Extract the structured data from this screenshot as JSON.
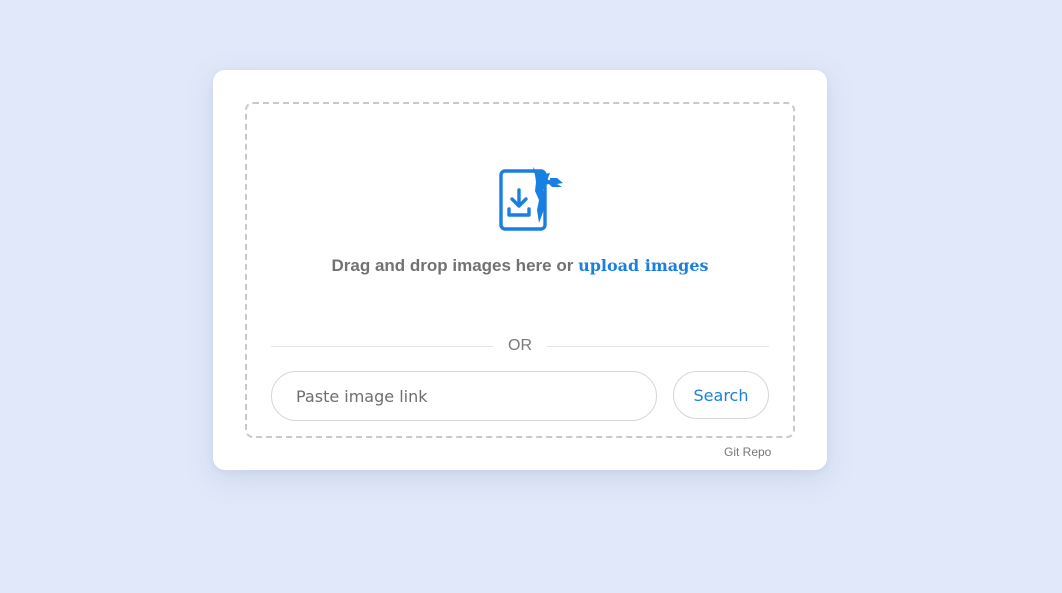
{
  "upload": {
    "icon": "document-download-dragon-icon",
    "prompt_text": "Drag and drop images here or",
    "link_text": "upload images"
  },
  "divider": {
    "label": "OR"
  },
  "search": {
    "placeholder": "Paste image link",
    "value": "",
    "button_label": "Search"
  },
  "footer": {
    "git_link": "Git Repo"
  },
  "colors": {
    "background": "#e0e8f9",
    "accent": "#1a7fe3",
    "card": "#ffffff",
    "muted_text": "#727272"
  }
}
